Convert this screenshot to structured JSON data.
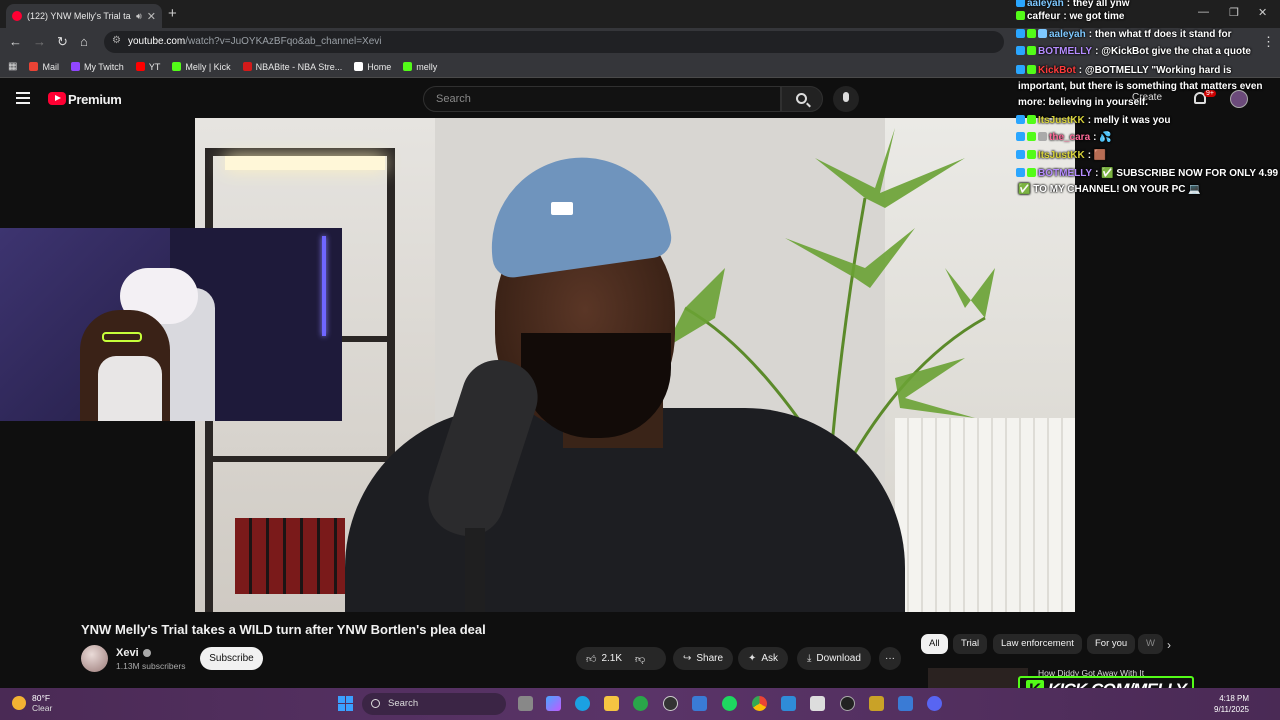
{
  "browser": {
    "tab_title": "(122) YNW Melly's Trial takes",
    "new_tab": "+",
    "url_host": "youtube.com",
    "url_path": "/watch?v=JuOYKAzBFqo&ab_channel=Xevi",
    "bookmarks": [
      {
        "label": "Mail",
        "color": "#ea4335",
        "icon": "gmail-icon"
      },
      {
        "label": "My Twitch",
        "color": "#9146ff",
        "icon": "twitch-icon"
      },
      {
        "label": "YT",
        "color": "#ff0000",
        "icon": "youtube-icon"
      },
      {
        "label": "Melly | Kick",
        "color": "#53fc18",
        "icon": "kick-icon"
      },
      {
        "label": "NBABite - NBA Stre...",
        "color": "#d31a1a",
        "icon": "nba-icon"
      },
      {
        "label": "Home",
        "color": "#ffffff",
        "icon": "x-icon"
      },
      {
        "label": "melly",
        "color": "#53fc18",
        "icon": "kick-icon"
      }
    ]
  },
  "youtube": {
    "brand": "Premium",
    "search_placeholder": "Search",
    "create_label": "Create",
    "notif_count": "9+"
  },
  "video": {
    "title": "YNW Melly's Trial takes a WILD turn after YNW Bortlen's plea deal",
    "channel": "Xevi",
    "subscribers": "1.13M subscribers",
    "subscribe_label": "Subscribe",
    "likes": "2.1K",
    "share_label": "Share",
    "ask_label": "Ask",
    "download_label": "Download",
    "more_label": "···"
  },
  "chips": [
    "All",
    "Trial",
    "Law enforcement",
    "For you",
    "W"
  ],
  "recommendation": {
    "title": "How Diddy Got Away With It"
  },
  "chat": [
    {
      "user": "aaleyah",
      "user_color": "#7ec8ff",
      "text": "they all ynw",
      "badges": [
        "#2aa6ff"
      ]
    },
    {
      "user": "caffeur",
      "user_color": "#ffffff",
      "text": "we got time",
      "badges": [
        "#53fc18"
      ]
    },
    {
      "user": "aaleyah",
      "user_color": "#7ec8ff",
      "text": "then what tf does it stand for",
      "badges": [
        "#2aa6ff",
        "#53fc18",
        "#7ec8ff"
      ]
    },
    {
      "user": "BOTMELLY",
      "user_color": "#b58cff",
      "text": "@KickBot give the chat a quote",
      "badges": [
        "#2aa6ff",
        "#53fc18"
      ]
    },
    {
      "user": "KickBot",
      "user_color": "#ff3b3b",
      "text": "@BOTMELLY \"Working hard is",
      "badges": [
        "#2aa6ff",
        "#53fc18"
      ]
    },
    {
      "user": "",
      "user_color": "#ffffff",
      "text": "important, but there is something that matters even",
      "badges": []
    },
    {
      "user": "",
      "user_color": "#ffffff",
      "text": "more: believing in yourself.",
      "badges": []
    },
    {
      "user": "ItsJustKK",
      "user_color": "#d7d23a",
      "text": "melly it was you",
      "badges": [
        "#2aa6ff",
        "#53fc18"
      ]
    },
    {
      "user": "the_cara",
      "user_color": "#ff6b9a",
      "text": "💦",
      "badges": [
        "#2aa6ff",
        "#53fc18",
        "#aaaaaa"
      ]
    },
    {
      "user": "ItsJustKK",
      "user_color": "#d7d23a",
      "text": "🟫",
      "badges": [
        "#2aa6ff",
        "#53fc18"
      ]
    },
    {
      "user": "BOTMELLY",
      "user_color": "#b58cff",
      "text": "✅ SUBSCRIBE NOW FOR ONLY 4.99",
      "badges": [
        "#2aa6ff",
        "#53fc18"
      ]
    },
    {
      "user": "",
      "user_color": "#ffffff",
      "text": "✅ TO MY CHANNEL! ON YOUR PC 💻",
      "badges": []
    }
  ],
  "kick_banner": {
    "k": "K",
    "text": "KICK.COM/MELLY"
  },
  "taskbar": {
    "temp": "80°F",
    "condition": "Clear",
    "search_label": "Search",
    "time": "4:18 PM",
    "date": "9/11/2025"
  }
}
